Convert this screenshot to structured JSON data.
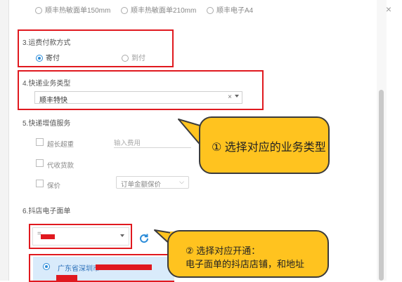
{
  "top_options": {
    "opt1": "顺丰热敏面单150mm",
    "opt2": "顺丰热敏面单210mm",
    "opt3": "顺丰电子A4"
  },
  "shipping_payment": {
    "title": "3.运费付款方式",
    "options": [
      "寄付",
      "到付"
    ],
    "selected": "寄付"
  },
  "business_type": {
    "title": "4.快递业务类型",
    "selected_value": "顺丰特快",
    "clear_symbol": "×"
  },
  "value_added": {
    "title": "5.快递增值服务",
    "items": [
      {
        "label": "超长超重",
        "input_placeholder": "输入费用"
      },
      {
        "label": "代收货款"
      },
      {
        "label": "保价",
        "select_value": "订单金额保价"
      }
    ]
  },
  "douyin_waybill": {
    "title": "6.抖店电子面单",
    "selected_prefix": "=",
    "store_address_visible": "广东省深圳市"
  },
  "callouts": {
    "one": "① 选择对应的业务类型",
    "two_line1": "② 选择对应开通：",
    "two_line2": "电子面单的抖店店铺，和地址"
  },
  "colors": {
    "highlight_red": "#e0191f",
    "callout_yellow": "#ffc31f",
    "accent_blue": "#2a8bd8"
  }
}
